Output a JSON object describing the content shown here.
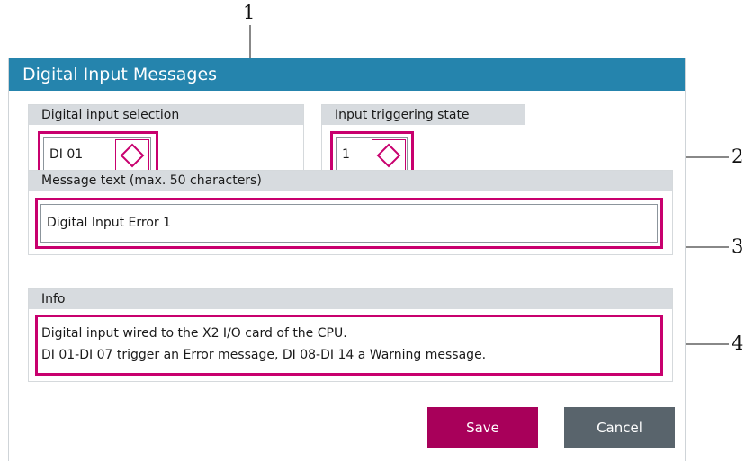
{
  "dialog": {
    "title": "Digital Input Messages",
    "digital_input": {
      "label": "Digital input selection",
      "value": "DI 01"
    },
    "trigger_state": {
      "label": "Input triggering state",
      "value": "1"
    },
    "message": {
      "label": "Message text (max. 50 characters)",
      "value": "Digital Input Error 1"
    },
    "info": {
      "label": "Info",
      "line1": "Digital input wired to the X2 I/O card of the CPU.",
      "line2": "DI 01-DI 07 trigger an Error message, DI 08-DI 14 a Warning message."
    },
    "buttons": {
      "save": "Save",
      "cancel": "Cancel"
    }
  },
  "callouts": [
    "1",
    "2",
    "3",
    "4"
  ],
  "colors": {
    "title_bar": "#2584ad",
    "highlight": "#c8006e",
    "save": "#a8005a",
    "cancel": "#59646c"
  }
}
